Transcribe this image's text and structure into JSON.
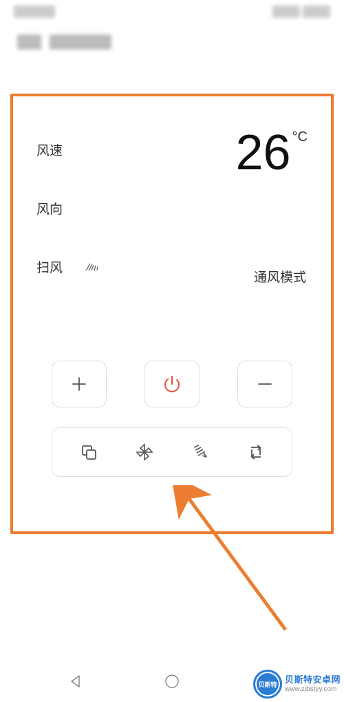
{
  "labels": {
    "fan_speed": "风速",
    "fan_direction": "风向",
    "sweep": "扫风"
  },
  "temperature": {
    "value": "26",
    "unit": "°C"
  },
  "mode_label": "通风模式",
  "icons": {
    "plus": "plus-icon",
    "power": "power-icon",
    "minus": "minus-icon",
    "copy": "copy-mode-icon",
    "fan": "pinwheel-fan-icon",
    "swing": "swing-icon",
    "cycle": "cycle-icon",
    "sweep_small": "sweep-small-icon"
  },
  "colors": {
    "accent": "#ED7D31",
    "power": "#E74C3C",
    "border": "#dddddd",
    "text": "#333333",
    "icon": "#555555"
  },
  "nav": {
    "back": "back",
    "home": "home",
    "recent": "recent"
  },
  "watermark": {
    "title": "贝斯特安卓网",
    "url": "www.zjbstyy.com",
    "badge": "贝斯特"
  }
}
